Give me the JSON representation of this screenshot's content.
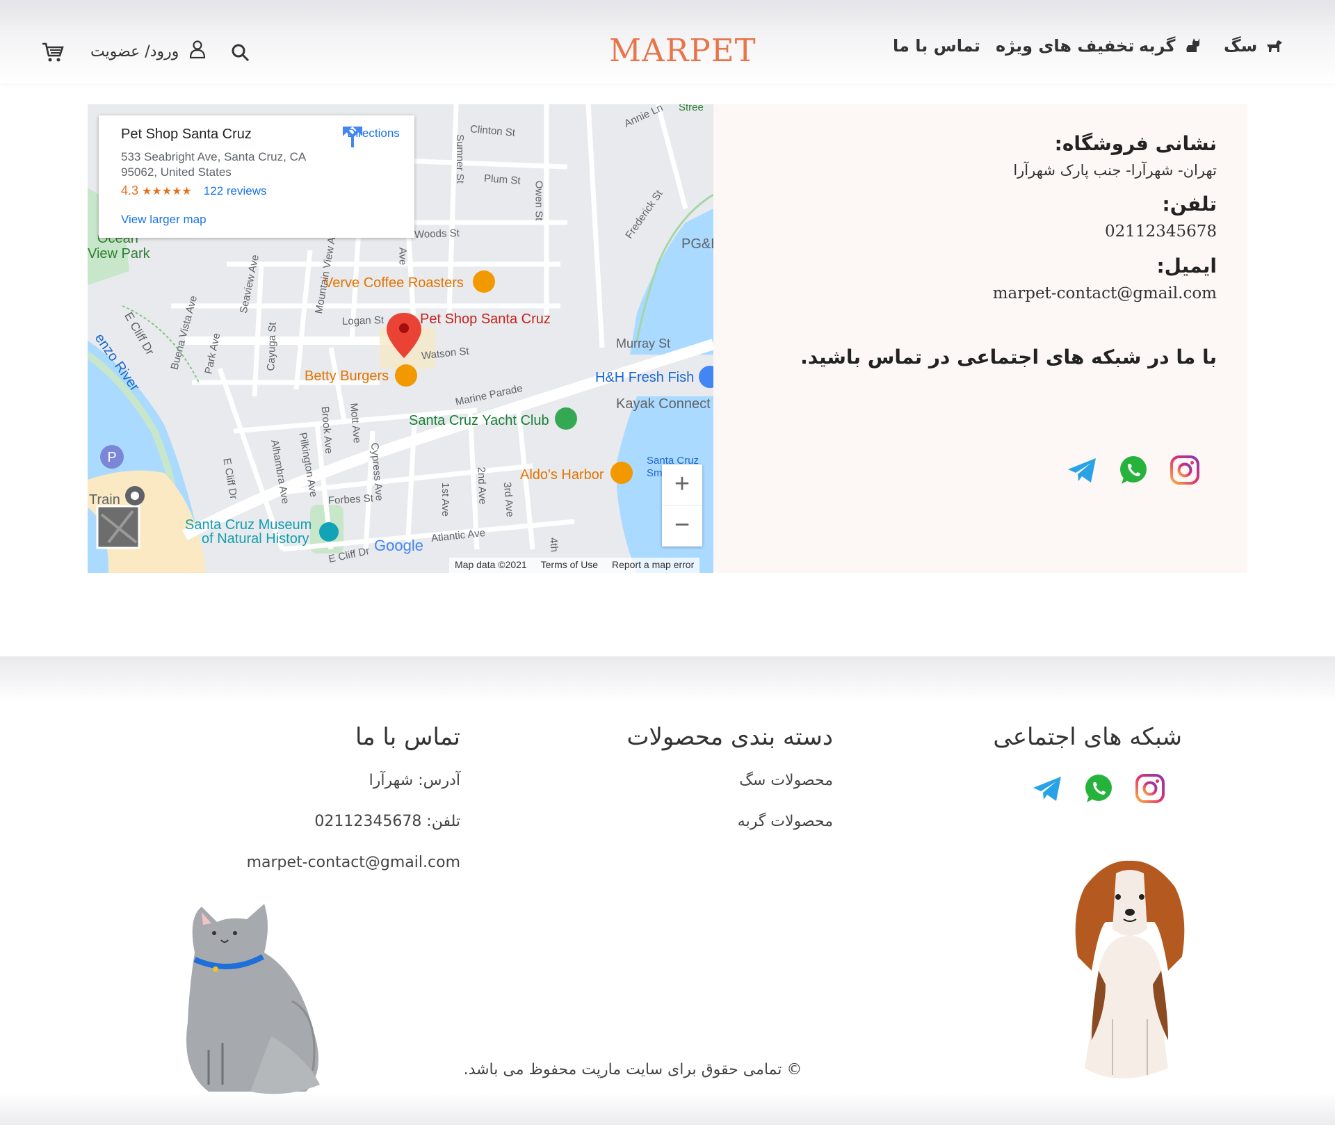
{
  "brand": {
    "logo": "MARPET",
    "accent": "#e8744a"
  },
  "header": {
    "nav": [
      {
        "id": "dog",
        "label": "سگ",
        "icon": "dog-icon"
      },
      {
        "id": "cat",
        "label": "گربه",
        "icon": "cat-icon"
      },
      {
        "id": "deals",
        "label": "تخفیف های ویژه"
      },
      {
        "id": "contact",
        "label": "تماس با ما"
      }
    ],
    "login_label": "ورود/ عضویت",
    "icons": [
      "search-icon",
      "user-icon",
      "cart-icon"
    ]
  },
  "map": {
    "place_name": "Pet Shop Santa Cruz",
    "address_line1": "533 Seabright Ave, Santa Cruz, CA",
    "address_line2": "95062, United States",
    "rating": "4.3",
    "stars": "★★★★★",
    "reviews": "122 reviews",
    "larger_map": "View larger map",
    "directions": "Directions",
    "zoom_in": "+",
    "zoom_out": "−",
    "attribution": {
      "data": "Map data ©2021",
      "terms": "Terms of Use",
      "report": "Report a map error"
    },
    "google": "Google",
    "pois": {
      "pet_shop": "Pet Shop Santa Cruz",
      "verve": "Verve Coffee Roasters",
      "betty": "Betty Burgers",
      "yacht": "Santa Cruz Yacht Club",
      "hh": "H&H Fresh Fish",
      "kayak": "Kayak Connect",
      "aldos": "Aldo's Harbor",
      "museum1": "Santa Cruz Museum",
      "museum2": "of Natural History",
      "park1": "Ocean",
      "park2": "View Park",
      "pge": "PG&E",
      "river": "enzo River",
      "train": "Train",
      "scs": "Santa Cruz",
      "scs2": "Sm"
    },
    "streets": {
      "clinton": "Clinton St",
      "plum": "Plum St",
      "woods": "Woods St",
      "logan": "Logan St",
      "watson": "Watson St",
      "murray": "Murray St",
      "marine": "Marine Parade",
      "forbes": "Forbes St",
      "atlantic": "Atlantic Ave",
      "frederick": "Frederick St",
      "annie": "Annie Ln",
      "sumner": "Sumner St",
      "owen": "Owen St",
      "seaview": "Seaview Ave",
      "mountain": "Mountain View Ave",
      "buena": "Buena Vista Ave",
      "park": "Park Ave",
      "cayuga": "Cayuga St",
      "ecliff": "E Cliff Dr",
      "alhambra": "Alhambra Ave",
      "pilkington": "Pilkington Ave",
      "brook": "Brook Ave",
      "mott": "Mott Ave",
      "cypress": "Cypress Ave",
      "first": "1st Ave",
      "second": "2nd Ave",
      "third": "3rd Ave",
      "fourth": "4th",
      "ave": "Ave",
      "ecliff2": "E Cliff Dr",
      "ecliff3": "E Cliff Dr",
      "stree": "Stree"
    }
  },
  "contact": {
    "address_title": "نشانی فروشگاه:",
    "address": "تهران- شهرآرا- جنب پارک شهرآرا",
    "phone_title": "تلفن:",
    "phone": "02112345678",
    "email_title": "ایمیل:",
    "email": "marpet-contact@gmail.com",
    "social_title": "با ما در شبکه های اجتماعی در تماس باشید."
  },
  "footer": {
    "social_title": "شبکه های اجتماعی",
    "categories_title": "دسته بندی محصولات",
    "categories": [
      "محصولات سگ",
      "محصولات گربه"
    ],
    "contact_title": "تماس با ما",
    "address": "آدرس: شهرآرا",
    "phone": "تلفن: 02112345678",
    "email": "marpet-contact@gmail.com",
    "copyright": "© تمامی حقوق برای سایت مارپت محفوظ می باشد."
  },
  "social_icons": [
    "instagram-icon",
    "whatsapp-icon",
    "telegram-icon"
  ],
  "colors": {
    "instagram": "#e1306c",
    "whatsapp": "#25b33b",
    "telegram": "#2aa3e6",
    "info_bg": "#fdf8f5"
  }
}
